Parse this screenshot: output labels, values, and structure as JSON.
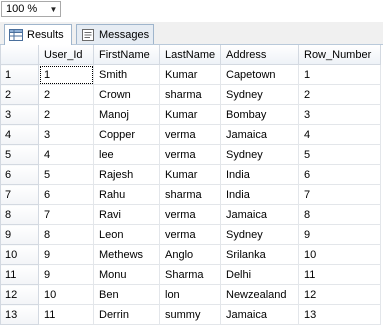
{
  "toolbar": {
    "zoom": "100 %"
  },
  "tabs": [
    {
      "label": "Results",
      "icon": "results-grid-icon"
    },
    {
      "label": "Messages",
      "icon": "messages-icon"
    }
  ],
  "grid": {
    "columns": [
      "User_Id",
      "FirstName",
      "LastName",
      "Address",
      "Row_Number"
    ],
    "row_numbers": [
      "1",
      "2",
      "3",
      "4",
      "5",
      "6",
      "7",
      "8",
      "9",
      "10",
      "11",
      "12",
      "13"
    ],
    "rows": [
      [
        "1",
        "Smith",
        "Kumar",
        "Capetown",
        "1"
      ],
      [
        "2",
        "Crown",
        "sharma",
        "Sydney",
        "2"
      ],
      [
        "2",
        "Manoj",
        "Kumar",
        "Bombay",
        "3"
      ],
      [
        "3",
        "Copper",
        "verma",
        "Jamaica",
        "4"
      ],
      [
        "4",
        "lee",
        "verma",
        "Sydney",
        "5"
      ],
      [
        "5",
        "Rajesh",
        "Kumar",
        "India",
        "6"
      ],
      [
        "6",
        "Rahu",
        "sharma",
        "India",
        "7"
      ],
      [
        "7",
        "Ravi",
        "verma",
        "Jamaica",
        "8"
      ],
      [
        "8",
        "Leon",
        "verma",
        "Sydney",
        "9"
      ],
      [
        "9",
        "Methews",
        "Anglo",
        "Srilanka",
        "10"
      ],
      [
        "9",
        "Monu",
        "Sharma",
        "Delhi",
        "11"
      ],
      [
        "10",
        "Ben",
        "lon",
        "Newzealand",
        "12"
      ],
      [
        "11",
        "Derrin",
        "summy",
        "Jamaica",
        "13"
      ]
    ]
  }
}
